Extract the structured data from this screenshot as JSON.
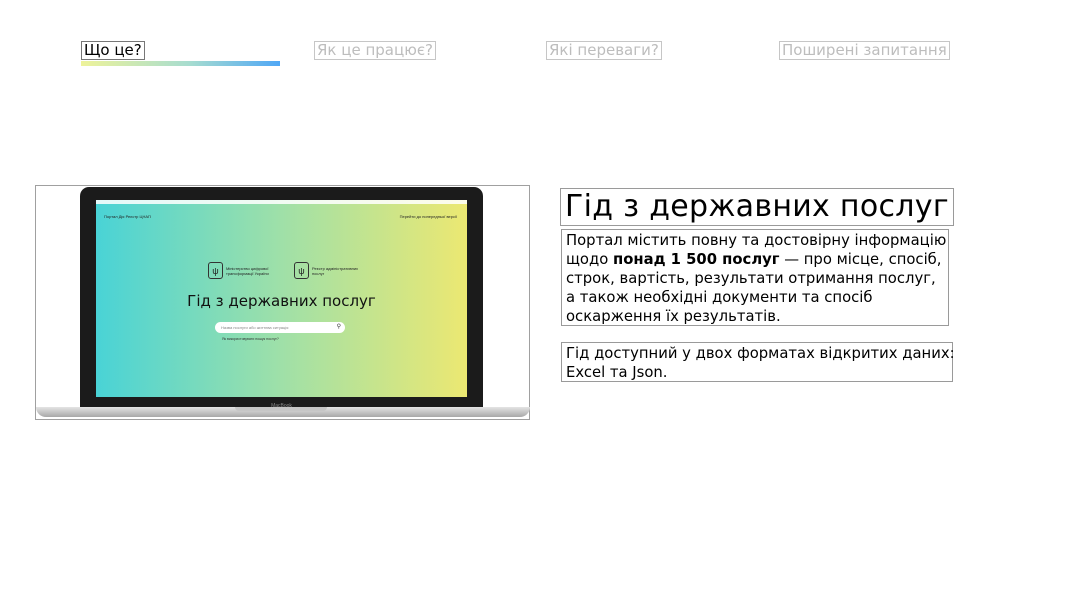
{
  "tabs": [
    {
      "label": "Що це?",
      "active": true
    },
    {
      "label": "Як це працює?",
      "active": false
    },
    {
      "label": "Які переваги?",
      "active": false
    },
    {
      "label": "Поширені запитання",
      "active": false
    }
  ],
  "laptop_screen": {
    "nav_left": "Портал Дія   Реєстр ЦНАП",
    "nav_right": "Перейти до попередньої версії",
    "emblem_glyph": "ψ",
    "org1": "Міністерство цифрової трансформації України",
    "org2": "Реєстр адміністративних послуг",
    "title": "Гід з державних послуг",
    "search_placeholder": "Назва послуги або життєва ситуація",
    "search_icon": "⚲",
    "search_subtext": "Як використовувати пошук послуг?",
    "brand": "MacBook"
  },
  "content": {
    "heading": "Гід з державних послуг",
    "paragraph1": {
      "line1": "Портал містить повну та достовірну інформацію",
      "line2_pre": "щодо ",
      "line2_bold": "понад 1 500 послуг",
      "line2_post": " — про місце, спосіб,",
      "line3": "строк, вартість, результати отримання послуг,",
      "line4": "а також необхідні документи та спосіб",
      "line5": "оскарження їх результатів."
    },
    "paragraph2": {
      "line1": "Гід доступний у двох форматах відкритих даних:",
      "line2": "Excel та Json."
    }
  },
  "colors": {
    "tab_underline_gradient": [
      "#eef39a",
      "#a6dcd0",
      "#4fa7f6"
    ],
    "screen_gradient": [
      "#49d3d6",
      "#9fe0a8",
      "#ece872"
    ]
  }
}
